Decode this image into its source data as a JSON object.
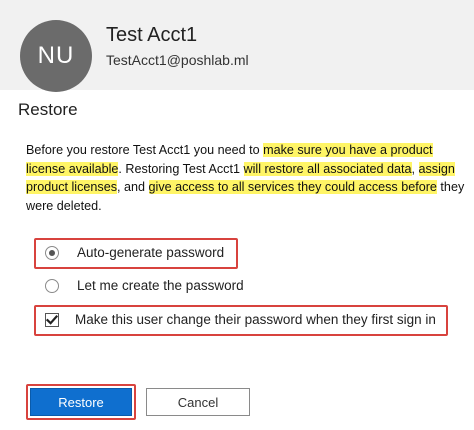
{
  "user": {
    "initials": "NU",
    "name": "Test Acct1",
    "email": "TestAcct1@poshlab.ml"
  },
  "panel": {
    "title": "Restore"
  },
  "description": {
    "p1": "Before you restore Test Acct1 you need to ",
    "h1": "make sure you have a product license available",
    "p2": ". Restoring Test Acct1 ",
    "h2": "will restore all associated data",
    "p3": ", ",
    "h3": "assign product licenses",
    "p4": ", and ",
    "h4": "give access to all services they could access before",
    "p5": " they were deleted."
  },
  "options": {
    "auto_generate_label": "Auto-generate password",
    "auto_generate_selected": true,
    "manual_label": "Let me create the password",
    "manual_selected": false,
    "force_change_label": "Make this user change their password when they first sign in",
    "force_change_checked": true
  },
  "buttons": {
    "restore_label": "Restore",
    "cancel_label": "Cancel"
  },
  "colors": {
    "highlight": "#fff566",
    "annotation_box": "#d8433e",
    "primary_button": "#0f6fcf",
    "avatar_bg": "#6b6b6b"
  }
}
